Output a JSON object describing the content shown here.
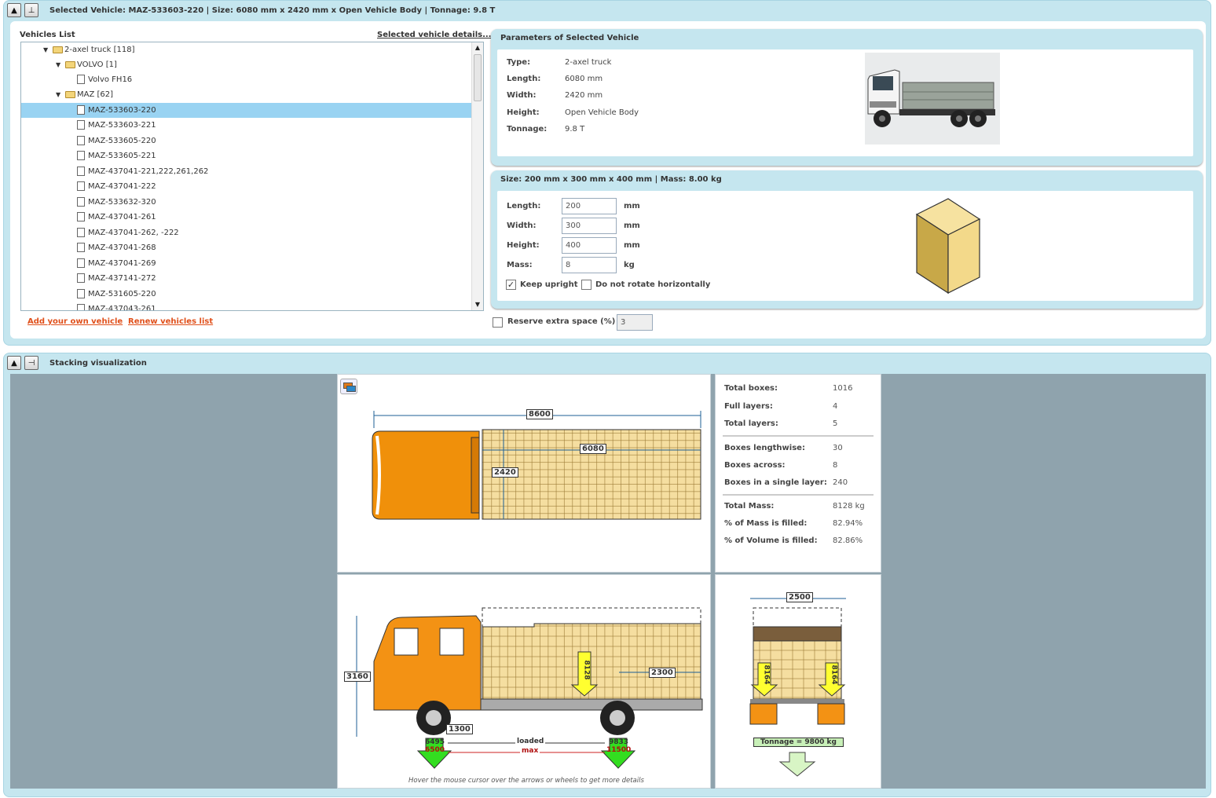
{
  "top_panel": {
    "title": "Selected Vehicle: MAZ-533603-220 | Size: 6080 mm x 2420 mm x Open Vehicle Body | Tonnage: 9.8 T"
  },
  "vehicles": {
    "list_label": "Vehicles List",
    "details_link": "Selected vehicle details...",
    "tree": [
      {
        "label": "2-axel truck [118]",
        "type": "folder"
      },
      {
        "label": "VOLVO [1]",
        "type": "folder"
      },
      {
        "label": "Volvo FH16",
        "type": "file"
      },
      {
        "label": "MAZ [62]",
        "type": "folder"
      },
      {
        "label": "MAZ-533603-220",
        "type": "file",
        "selected": true
      },
      {
        "label": "MAZ-533603-221",
        "type": "file"
      },
      {
        "label": "MAZ-533605-220",
        "type": "file"
      },
      {
        "label": "MAZ-533605-221",
        "type": "file"
      },
      {
        "label": "MAZ-437041-221,222,261,262",
        "type": "file"
      },
      {
        "label": "MAZ-437041-222",
        "type": "file"
      },
      {
        "label": "MAZ-533632-320",
        "type": "file"
      },
      {
        "label": "MAZ-437041-261",
        "type": "file"
      },
      {
        "label": "MAZ-437041-262, -222",
        "type": "file"
      },
      {
        "label": "MAZ-437041-268",
        "type": "file"
      },
      {
        "label": "MAZ-437041-269",
        "type": "file"
      },
      {
        "label": "MAZ-437141-272",
        "type": "file"
      },
      {
        "label": "MAZ-531605-220",
        "type": "file"
      },
      {
        "label": "MAZ-437043-261",
        "type": "file"
      }
    ],
    "add_link": "Add your own vehicle",
    "renew_link": "Renew vehicles list"
  },
  "params": {
    "title": "Parameters of Selected Vehicle",
    "rows": [
      {
        "label": "Type:",
        "value": "2-axel truck"
      },
      {
        "label": "Length:",
        "value": "6080 mm"
      },
      {
        "label": "Width:",
        "value": "2420 mm"
      },
      {
        "label": "Height:",
        "value": "Open Vehicle Body"
      },
      {
        "label": "Tonnage:",
        "value": "9.8 T"
      }
    ]
  },
  "box": {
    "title": "Size: 200 mm x 300 mm x 400 mm | Mass: 8.00 kg",
    "fields": [
      {
        "label": "Length:",
        "value": "200",
        "unit": "mm"
      },
      {
        "label": "Width:",
        "value": "300",
        "unit": "mm"
      },
      {
        "label": "Height:",
        "value": "400",
        "unit": "mm"
      },
      {
        "label": "Mass:",
        "value": "8",
        "unit": "kg"
      }
    ],
    "keep_upright": "Keep upright",
    "keep_upright_checked": true,
    "no_rotate": "Do not rotate horizontally",
    "no_rotate_checked": false,
    "reserve_label": "Reserve extra space (%)",
    "reserve_value": "3",
    "reserve_checked": false
  },
  "viz": {
    "title": "Stacking visualization",
    "top_dims": {
      "total_length": "8600",
      "body_length": "6080",
      "body_width": "2420"
    },
    "side_dims": {
      "height": "3160",
      "axle_offset": "1300",
      "body_to_rear": "2300",
      "load": "8128"
    },
    "front_axle": {
      "loaded": "6495",
      "max": "6500"
    },
    "rear_axle": {
      "loaded": "9833",
      "max": "11500"
    },
    "legend_loaded": "loaded",
    "legend_max": "max",
    "hint": "Hover the mouse cursor over the arrows or wheels to get more details",
    "rear_dims": {
      "width": "2500",
      "left_load": "8164",
      "right_load": "8164",
      "tonnage": "Tonnage = 9800 kg"
    },
    "stats": [
      {
        "label": "Total boxes:",
        "value": "1016"
      },
      {
        "label": "Full layers:",
        "value": "4"
      },
      {
        "label": "Total layers:",
        "value": "5"
      },
      {
        "label": "Boxes lengthwise:",
        "value": "30"
      },
      {
        "label": "Boxes across:",
        "value": "8"
      },
      {
        "label": "Boxes in a single layer:",
        "value": "240"
      },
      {
        "label": "Total Mass:",
        "value": "8128 kg"
      },
      {
        "label": "% of Mass is filled:",
        "value": "82.94%"
      },
      {
        "label": "% of Volume is filled:",
        "value": "82.86%"
      }
    ]
  }
}
